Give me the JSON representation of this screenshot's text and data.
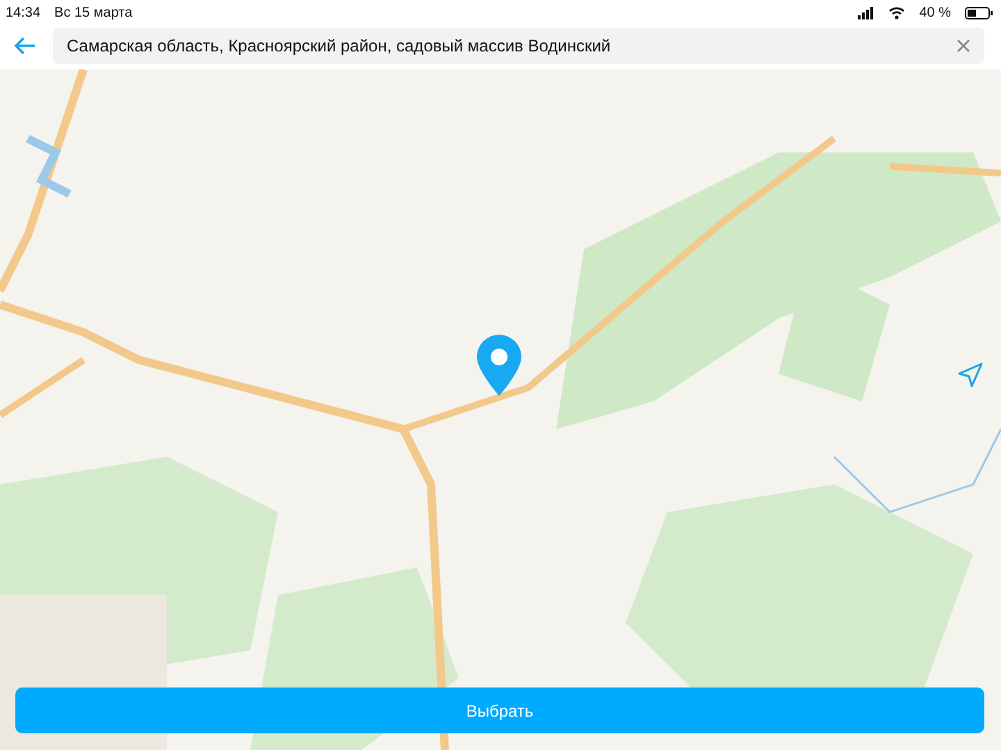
{
  "status_bar": {
    "time": "14:34",
    "date": "Вс 15 марта",
    "battery": "40 %"
  },
  "search": {
    "value": "Самарская область, Красноярский район, садовый массив Водинский"
  },
  "action_button": {
    "label": "Выбрать"
  }
}
